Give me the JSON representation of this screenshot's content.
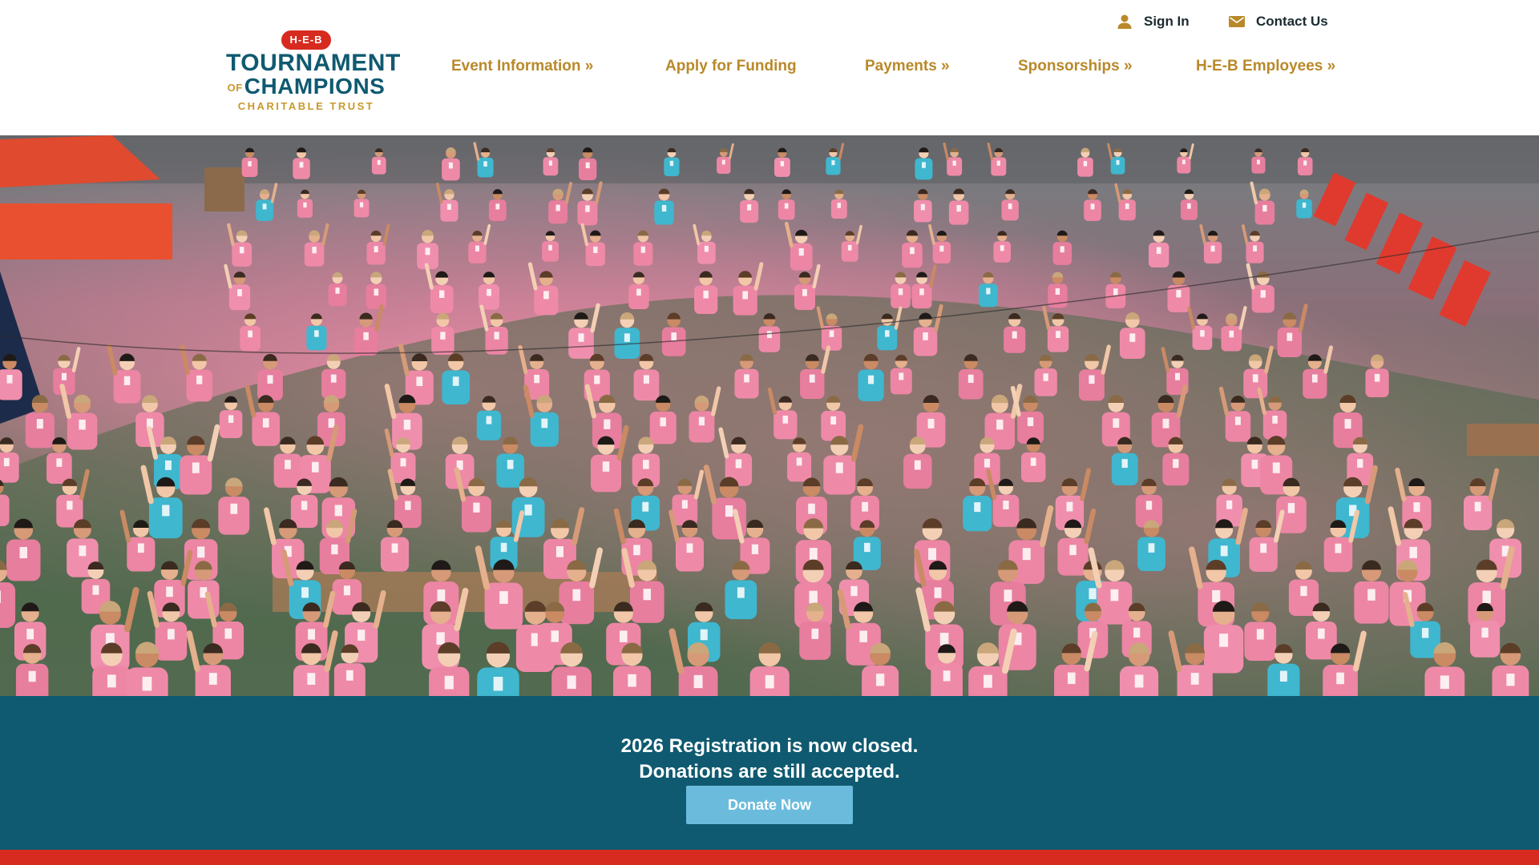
{
  "logo": {
    "badge": "H-E-B",
    "line1": "TOURNAMENT",
    "line2_prefix": "OF",
    "line2": "CHAMPIONS",
    "line3": "CHARITABLE TRUST"
  },
  "utility": {
    "sign_in": "Sign In",
    "contact_us": "Contact Us",
    "sign_in_icon": "person-icon",
    "contact_icon": "envelope-icon"
  },
  "nav": {
    "items": [
      {
        "label": "Event Information »"
      },
      {
        "label": "Apply for Funding"
      },
      {
        "label": "Payments »"
      },
      {
        "label": "Sponsorships »"
      },
      {
        "label": "H-E-B Employees »"
      }
    ]
  },
  "hero": {
    "description_icon": "group-photo"
  },
  "banner": {
    "line1": "2026 Registration is now closed.",
    "line2": "Donations are still accepted.",
    "donate_label": "Donate Now"
  },
  "colors": {
    "brand_teal": "#0f5a70",
    "brand_gold": "#b9892a",
    "brand_red": "#d72b1f",
    "button_blue": "#6bbcdc"
  }
}
